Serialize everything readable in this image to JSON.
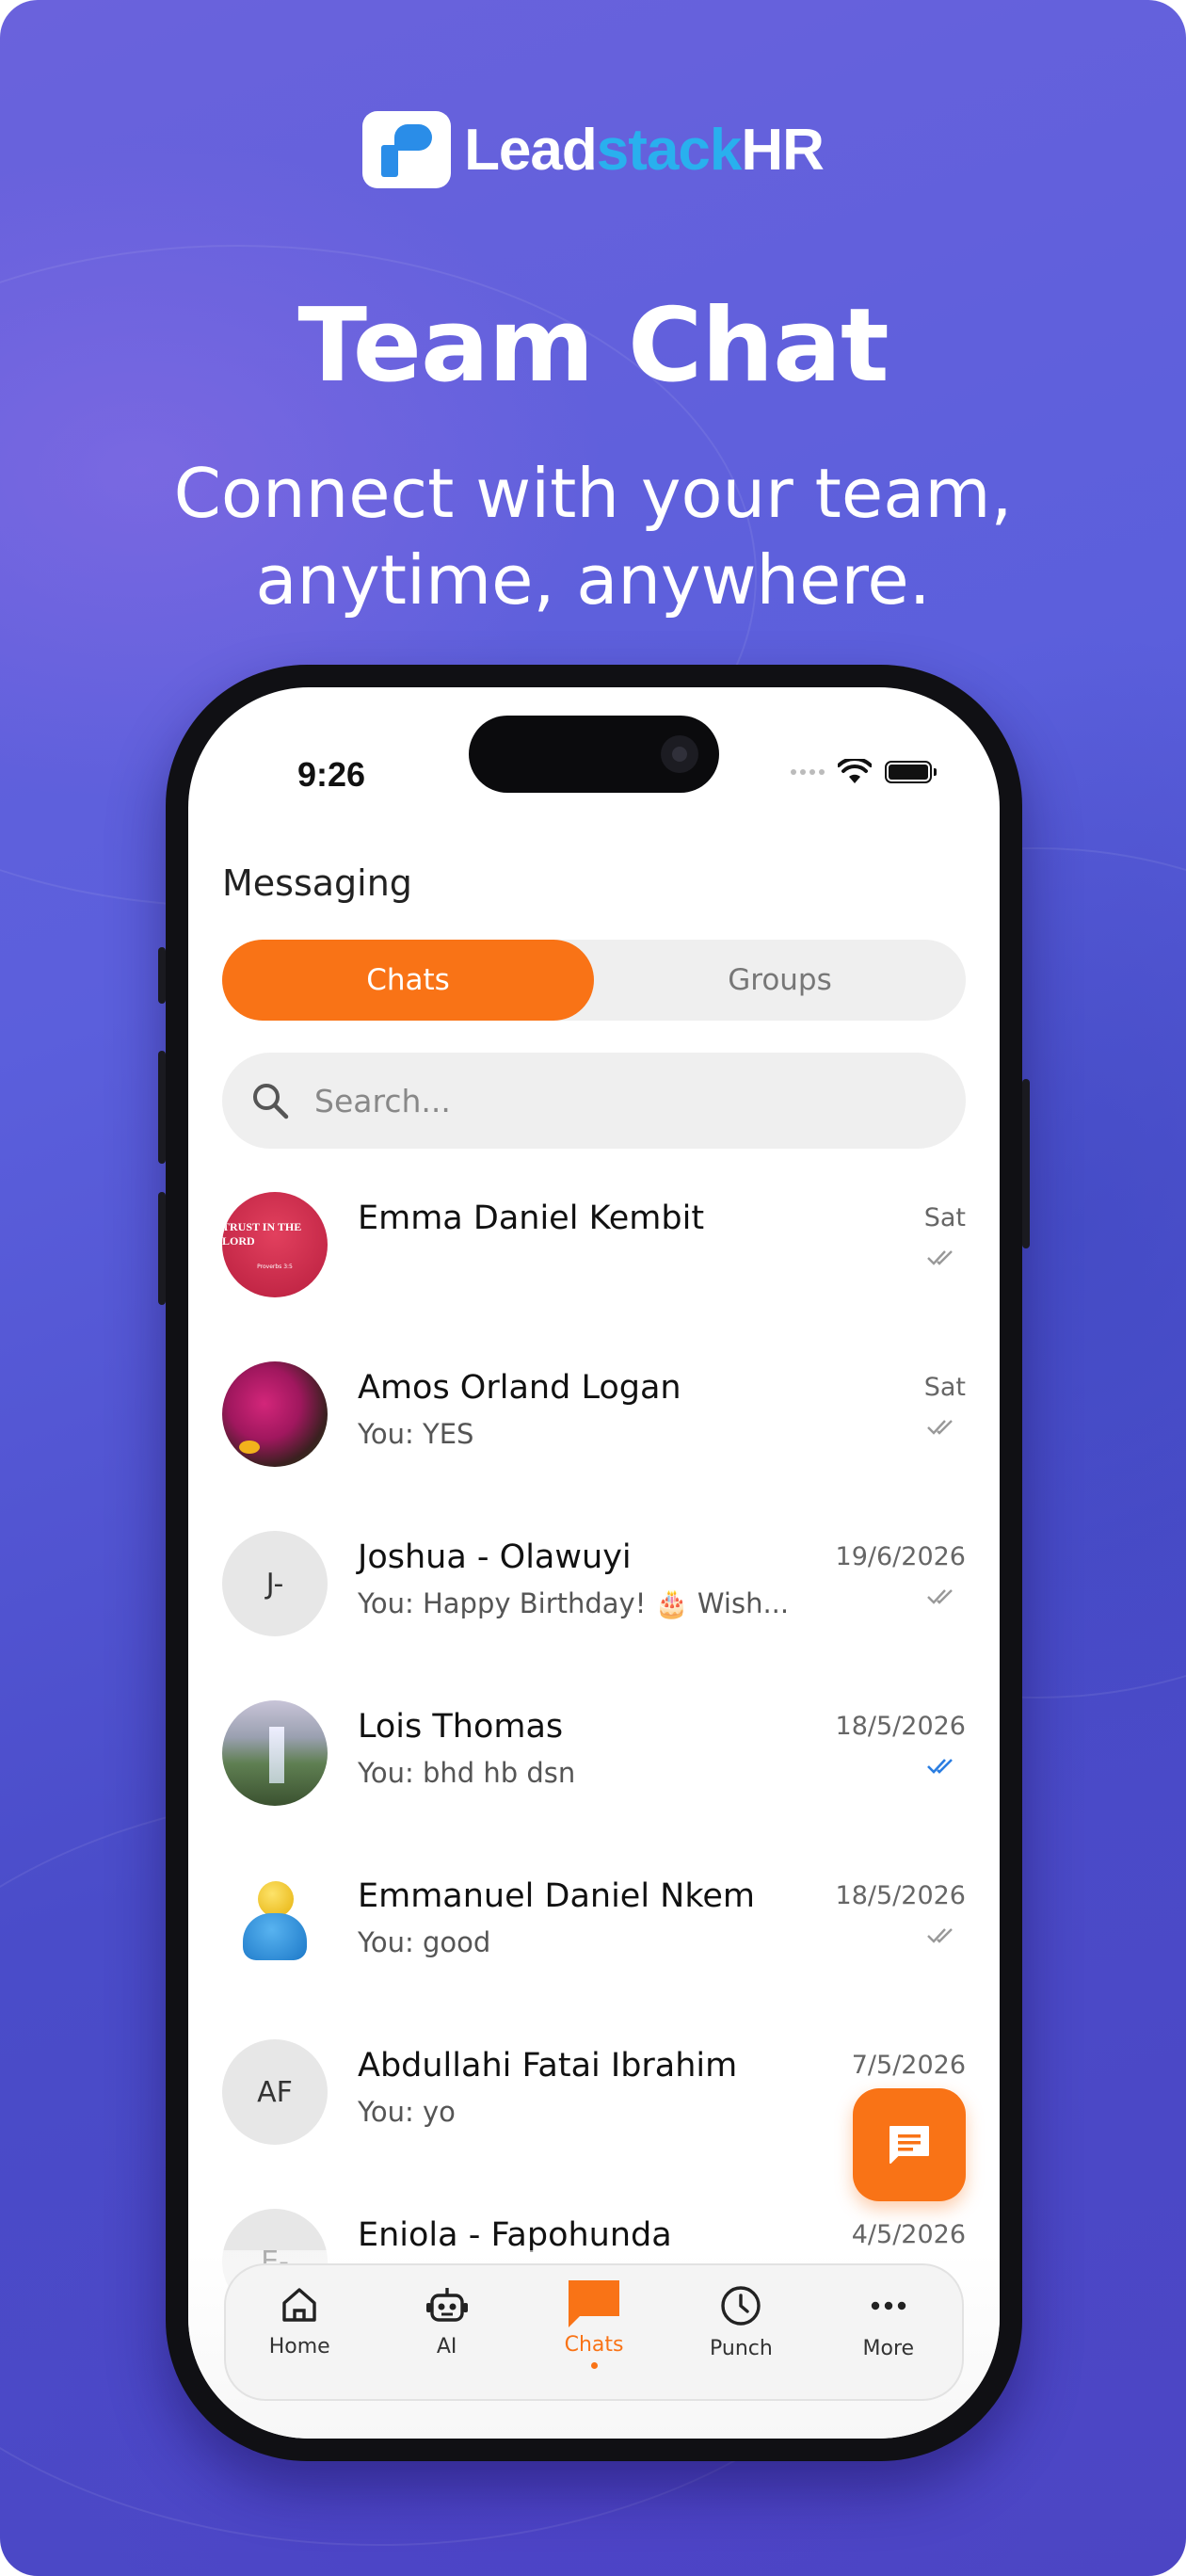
{
  "brand": {
    "logo_white": "Lead",
    "logo_blue": "stack",
    "logo_white2": "HR"
  },
  "headline": "Team Chat",
  "subheadline": {
    "line1": "Connect with your team,",
    "line2": "anytime, anywhere."
  },
  "status_bar": {
    "time": "9:26"
  },
  "screen_title": "Messaging",
  "tabs": {
    "chats": "Chats",
    "groups": "Groups",
    "active": "Chats"
  },
  "search": {
    "placeholder": "Search..."
  },
  "chats": [
    {
      "name": "Emma Daniel Kembit",
      "preview": "",
      "date": "Sat",
      "read": false,
      "avatar_text": "TRUST IN THE LORD",
      "avatar_sub": "Proverbs 3:5"
    },
    {
      "name": "Amos Orland Logan",
      "preview": "You: YES",
      "date": "Sat",
      "read": false
    },
    {
      "name": "Joshua - Olawuyi",
      "preview": "You: Happy Birthday! 🎂 Wish...",
      "date": "19/6/2026",
      "read": false,
      "initials": "J-"
    },
    {
      "name": "Lois Thomas",
      "preview": "You: bhd hb dsn",
      "date": "18/5/2026",
      "read": true
    },
    {
      "name": "Emmanuel Daniel Nkem",
      "preview": "You: good",
      "date": "18/5/2026",
      "read": false
    },
    {
      "name": "Abdullahi Fatai Ibrahim",
      "preview": "You: yo",
      "date": "7/5/2026",
      "read": false,
      "initials": "AF"
    },
    {
      "name": "Eniola - Fapohunda",
      "preview": "",
      "date": "4/5/2026",
      "read": false,
      "initials": "E-"
    }
  ],
  "bottom_nav": [
    {
      "label": "Home",
      "icon": "home-icon"
    },
    {
      "label": "AI",
      "icon": "robot-icon"
    },
    {
      "label": "Chats",
      "icon": "chat-bubble-icon",
      "active": true
    },
    {
      "label": "Punch",
      "icon": "clock-icon"
    },
    {
      "label": "More",
      "icon": "more-dots-icon"
    }
  ],
  "colors": {
    "accent": "#f97316",
    "read_tick": "#2a7de1",
    "bg_gradient": [
      "#6a62dc",
      "#4a4cc9"
    ]
  }
}
